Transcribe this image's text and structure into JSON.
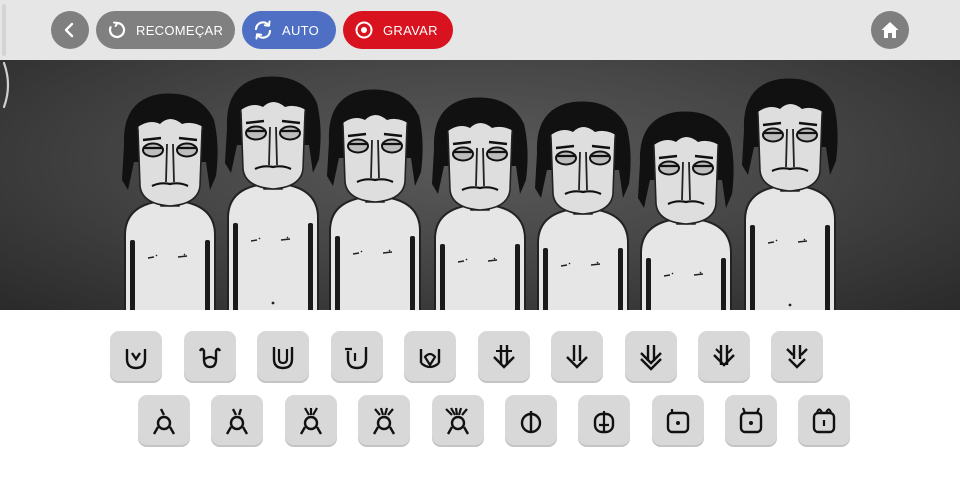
{
  "toolbar": {
    "back_icon": "chevron-left-icon",
    "restart": {
      "label": "RECOMEÇAR",
      "icon": "restart-icon",
      "color": "#808080"
    },
    "auto": {
      "label": "AUTO",
      "icon": "sync-icon",
      "color": "#4e6fc4"
    },
    "record": {
      "label": "GRAVAR",
      "icon": "record-icon",
      "color": "#d8121e"
    },
    "home_icon": "home-icon",
    "background": "#e6e6e6"
  },
  "stage": {
    "performers": 7,
    "background": "#4a4a4a"
  },
  "sound_icons": {
    "row_1": [
      "beat-icon-1",
      "beat-icon-2",
      "beat-icon-3",
      "beat-icon-4",
      "beat-icon-5",
      "effect-icon-1",
      "effect-icon-2",
      "effect-icon-3",
      "effect-icon-4",
      "effect-icon-5"
    ],
    "row_2": [
      "melody-icon-1",
      "melody-icon-2",
      "melody-icon-3",
      "melody-icon-4",
      "melody-icon-5",
      "voice-icon-1",
      "voice-icon-2",
      "voice-icon-3",
      "voice-icon-4",
      "voice-icon-5"
    ],
    "slot_color": "#d8d8d8"
  }
}
